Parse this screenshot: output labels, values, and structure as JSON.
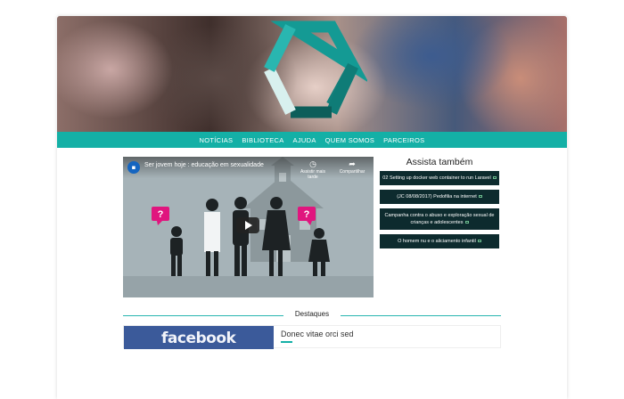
{
  "nav": {
    "items": [
      "NOTÍCIAS",
      "BIBLIOTECA",
      "AJUDA",
      "QUEM SOMOS",
      "PARCEIROS"
    ]
  },
  "video": {
    "title": "Ser jovem hoje : educação em sexualidade",
    "watch_later": "Assistir mais tarde",
    "share": "Compartilhar"
  },
  "sidebar": {
    "title": "Assista também",
    "items": [
      "02 Setting up docker web container to run Laravel",
      "(JC 08/08/2017) Pedofilia na internet",
      "Campanha contra o abuso e exploração sexual de crianças e adolescentes",
      "O homem nu e o aliciamento infantil"
    ]
  },
  "highlights": {
    "section_title": "Destaques",
    "card_image_text": "facebook",
    "card_title": "Donec vitae orci sed"
  },
  "colors": {
    "accent": "#14b0a6",
    "dark_item": "#0d2b2e",
    "video_bg": "#a6b3b8",
    "question_bubble": "#e0157e"
  }
}
